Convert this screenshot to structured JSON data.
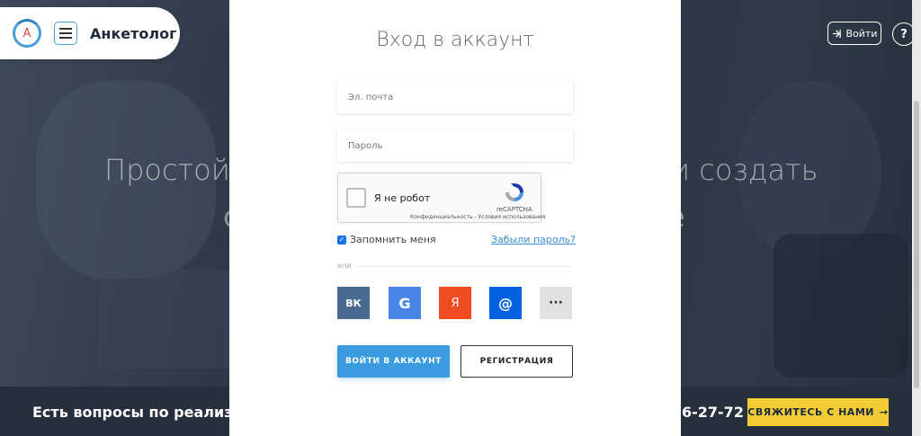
{
  "header": {
    "logo_letter": "A",
    "brand_name": "Анкетолог",
    "login_label": "Войти",
    "help_label": "?"
  },
  "hero": {
    "text_left": "Простой",
    "text_right": "и создать",
    "fragment_left": "с",
    "fragment_right": "е"
  },
  "bottom": {
    "question_text": "Есть вопросы по реализа",
    "phone_fragment": "6-27-72",
    "cta_label": "СВЯЖИТЕСЬ С НАМИ",
    "cta_arrow": "→"
  },
  "modal": {
    "title": "Вход в аккаунт",
    "email_placeholder": "Эл. почта",
    "password_placeholder": "Пароль",
    "captcha": {
      "label": "Я не робот",
      "brand": "reCAPTCHA",
      "links": "Конфиденциальность - Условия использования"
    },
    "remember_label": "Запомнить меня",
    "forgot_label": "Забыли пароль?",
    "or_label": "или",
    "social": {
      "vk": "ВК",
      "google": "G",
      "yandex": "Я",
      "mail": "@",
      "more": "···"
    },
    "login_button": "ВОЙТИ В АККАУНТ",
    "register_button": "РЕГИСТРАЦИЯ"
  },
  "colors": {
    "accent_blue": "#3a9be0",
    "cta_yellow": "#f1cc35",
    "vk": "#4a6b91",
    "google": "#4a86e8",
    "yandex": "#f04d22",
    "mail": "#0062e3"
  }
}
